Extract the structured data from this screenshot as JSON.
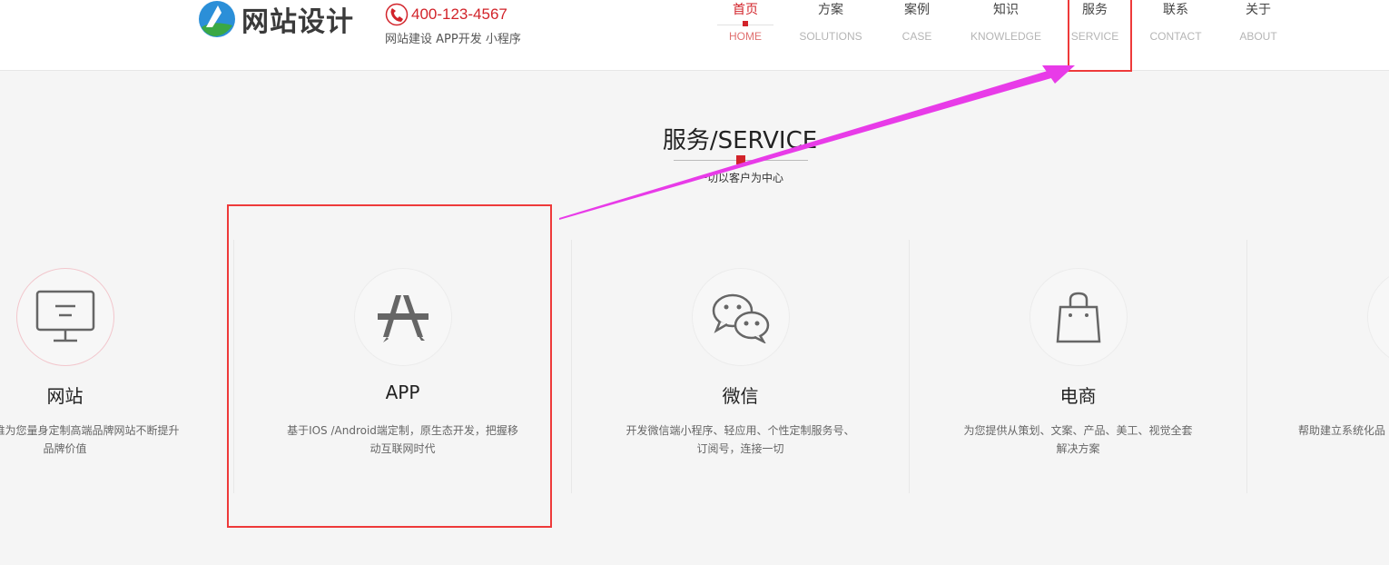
{
  "header": {
    "logo_text": "网站设计",
    "phone": "400-123-4567",
    "tagline": "网站建设 APP开发 小程序"
  },
  "nav": [
    {
      "cn": "首页",
      "en": "HOME",
      "active": true
    },
    {
      "cn": "方案",
      "en": "SOLUTIONS",
      "active": false
    },
    {
      "cn": "案例",
      "en": "CASE",
      "active": false
    },
    {
      "cn": "知识",
      "en": "KNOWLEDGE",
      "active": false
    },
    {
      "cn": "服务",
      "en": "SERVICE",
      "active": false
    },
    {
      "cn": "联系",
      "en": "CONTACT",
      "active": false
    },
    {
      "cn": "关于",
      "en": "ABOUT",
      "active": false
    }
  ],
  "section": {
    "title": "服务/SERVICE",
    "subtitle": "一切以客户为中心"
  },
  "cards": [
    {
      "icon": "monitor-icon",
      "title": "网站",
      "desc": "互联网思维为您量身定制高端品牌网站不断提升品牌价值"
    },
    {
      "icon": "app-store-icon",
      "title": "APP",
      "desc": "基于IOS /Android端定制，原生态开发，把握移动互联网时代"
    },
    {
      "icon": "wechat-icon",
      "title": "微信",
      "desc": "开发微信端小程序、轻应用、个性定制服务号、订阅号，连接一切"
    },
    {
      "icon": "shopping-bag-icon",
      "title": "电商",
      "desc": "为您提供从策划、文案、产品、美工、视觉全套解决方案"
    },
    {
      "icon": "system-icon",
      "title": "",
      "desc": "帮助建立系统化品"
    }
  ],
  "colors": {
    "accent": "#d2232a",
    "annotation": "#ee3a3a",
    "arrow": "#e83be8"
  }
}
